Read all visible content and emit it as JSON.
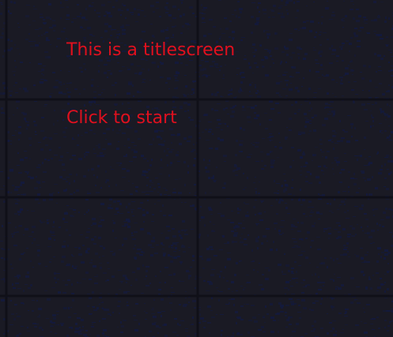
{
  "title_screen": {
    "title": "This is a titlescreen",
    "prompt": "Click to start"
  },
  "colors": {
    "text": "#e0101e",
    "background_base": "#1a1a24",
    "background_speckle": "#141a3c",
    "tile_border": "#0f0f16"
  }
}
